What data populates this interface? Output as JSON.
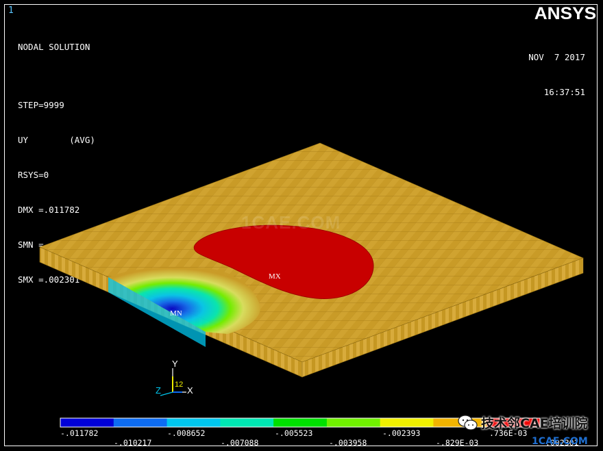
{
  "window": {
    "number": "1"
  },
  "logo": "ANSYS",
  "info_lines": [
    "NODAL SOLUTION",
    "",
    "STEP=9999",
    "UY        (AVG)",
    "RSYS=0",
    "DMX =.011782",
    "SMN =-.011782",
    "SMX =.002301"
  ],
  "date": "NOV  7 2017",
  "time": "16:37:51",
  "markers": {
    "max": "MX",
    "min": "MN"
  },
  "triad": {
    "y": "Y",
    "x": "X",
    "z": "Z",
    "num": "12"
  },
  "watermark": "1CAE.COM",
  "legend": {
    "colors": [
      "#0000d8",
      "#0d6cf2",
      "#00c6ee",
      "#00e8b4",
      "#00e000",
      "#70f000",
      "#f0f000",
      "#f2b400",
      "#f00000"
    ],
    "top_labels": [
      "-.011782",
      "-.008652",
      "-.005523",
      "-.002393",
      ".736E-03"
    ],
    "bottom_labels": [
      "-.010217",
      "-.007088",
      "-.003958",
      "-.829E-03",
      ".002301"
    ]
  },
  "overlay": {
    "wechat": "技术邻CAE培训院",
    "site": "1CAE.COM"
  },
  "plate_colors": {
    "top": "#c99b27",
    "top_light": "#d8ad3a",
    "side": "#b88d1e",
    "max": "#c80000",
    "min": "#0000c8"
  }
}
